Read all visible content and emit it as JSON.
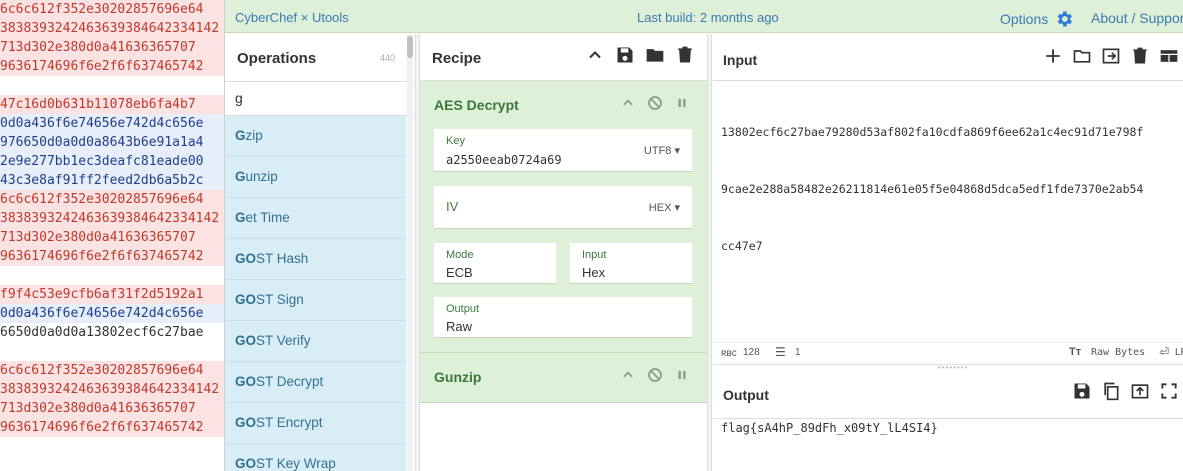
{
  "background": {
    "lines": [
      {
        "text": "6c6c612f352e30202857696e64",
        "style": "red"
      },
      {
        "text": "3838393242463639384642334142",
        "style": "red"
      },
      {
        "text": "713d302e380d0a41636365707",
        "style": "red"
      },
      {
        "text": "9636174696f6e2f6f637465742",
        "style": "red"
      },
      {
        "text": "",
        "style": "plain"
      },
      {
        "text": "47c16d0b631b11078eb6fa4b7",
        "style": "red"
      },
      {
        "text": "0d0a436f6e74656e742d4c656e",
        "style": "blue"
      },
      {
        "text": "976650d0a0d0a8643b6e91a1a4",
        "style": "blue"
      },
      {
        "text": "2e9e277bb1ec3deafc81eade00",
        "style": "blue"
      },
      {
        "text": "43c3e8af91ff2feed2db6a5b2c",
        "style": "blue"
      },
      {
        "text": "6c6c612f352e30202857696e64",
        "style": "red"
      },
      {
        "text": "3838393242463639384642334142",
        "style": "red"
      },
      {
        "text": "713d302e380d0a41636365707",
        "style": "red"
      },
      {
        "text": "9636174696f6e2f6f637465742",
        "style": "red"
      },
      {
        "text": "",
        "style": "plain"
      },
      {
        "text": "f9f4c53e9cfb6af31f2d5192a1",
        "style": "red"
      },
      {
        "text": "0d0a436f6e74656e742d4c656e",
        "style": "blue"
      },
      {
        "text": "6650d0a0d0a13802ecf6c27bae",
        "style": "plain"
      },
      {
        "text": "",
        "style": "plain"
      },
      {
        "text": "6c6c612f352e30202857696e64",
        "style": "red"
      },
      {
        "text": "3838393242463639384642334142",
        "style": "red"
      },
      {
        "text": "713d302e380d0a41636365707",
        "style": "red"
      },
      {
        "text": "9636174696f6e2f6f637465742",
        "style": "red"
      }
    ]
  },
  "topbar": {
    "title": "CyberChef × Utools",
    "build": "Last build: 2 months ago",
    "options": "Options",
    "about": "About / Support"
  },
  "operations": {
    "title": "Operations",
    "count": "440",
    "search_value": "g",
    "items": [
      {
        "match": "G",
        "rest": "zip"
      },
      {
        "match": "G",
        "rest": "unzip"
      },
      {
        "match": "G",
        "rest": "et Time"
      },
      {
        "match": "GO",
        "rest": "ST Hash"
      },
      {
        "match": "GO",
        "rest": "ST Sign"
      },
      {
        "match": "GO",
        "rest": "ST Verify"
      },
      {
        "match": "GO",
        "rest": "ST Decrypt"
      },
      {
        "match": "GO",
        "rest": "ST Encrypt"
      },
      {
        "match": "GO",
        "rest": "ST Key Wrap"
      }
    ]
  },
  "recipe": {
    "title": "Recipe",
    "aes": {
      "name": "AES Decrypt",
      "key_label": "Key",
      "key_value": "a2550eeab0724a69",
      "key_encoding": "UTF8",
      "iv_label": "IV",
      "iv_encoding": "HEX",
      "mode_label": "Mode",
      "mode_value": "ECB",
      "input_label": "Input",
      "input_value": "Hex",
      "output_label": "Output",
      "output_value": "Raw"
    },
    "gunzip": {
      "name": "Gunzip"
    }
  },
  "input": {
    "title": "Input",
    "lines": [
      "13802ecf6c27bae79280d53af802fa10cdfa869f6ee62a1c4ec91d71e798f",
      "9cae2e288a58482e26211814e61e05f5e04868d5dca5edf1fde7370e2ab54",
      "cc47e7"
    ],
    "char_count": "128",
    "line_count": "1",
    "encoding": "Raw Bytes",
    "eol": "LF"
  },
  "output": {
    "title": "Output",
    "text": "flag{sA4hP_89dFh_x09tY_lL4SI4}"
  },
  "colors": {
    "topbar_bg": "#dff0d8",
    "link": "#3a7ab3",
    "op_list_bg": "#d9edf7",
    "recipe_op_bg": "#dff0d8",
    "gear": "#3a7ab3"
  }
}
